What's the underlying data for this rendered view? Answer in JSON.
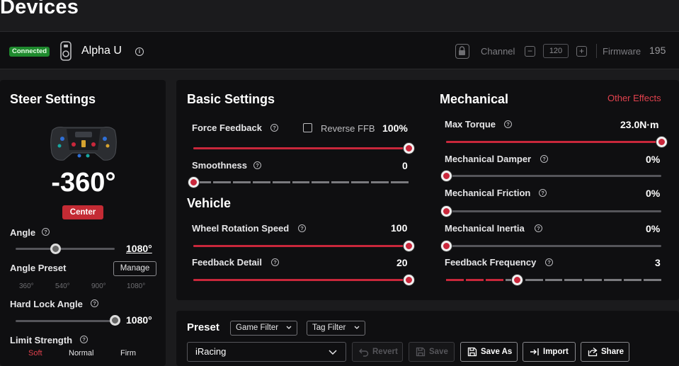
{
  "page": {
    "title": "Devices"
  },
  "device": {
    "status": "Connected",
    "name": "Alpha U",
    "channel_label": "Channel",
    "channel_value": "120",
    "minus": "−",
    "plus": "+",
    "firmware_label": "Firmware",
    "firmware_value": "195"
  },
  "steer": {
    "title": "Steer Settings",
    "angle_display": "-360°",
    "center_label": "Center",
    "angle_label": "Angle",
    "angle_value": "1080°",
    "angle_fraction": 0.4,
    "angle_preset_label": "Angle Preset",
    "manage_label": "Manage",
    "presets": [
      "360°",
      "540°",
      "900°",
      "1080°"
    ],
    "hard_lock_label": "Hard Lock Angle",
    "hard_lock_value": "1080°",
    "hard_lock_fraction": 1.0,
    "limit_strength_label": "Limit Strength",
    "limit_options": [
      "Soft",
      "Normal",
      "Firm"
    ]
  },
  "basic": {
    "title": "Basic Settings",
    "force_feedback_label": "Force Feedback",
    "reverse_ffb_label": "Reverse FFB",
    "force_feedback_value": "100%",
    "force_feedback_fraction": 1.0,
    "smoothness_label": "Smoothness",
    "smoothness_value": "0",
    "smoothness_fraction": 0.0
  },
  "vehicle": {
    "title": "Vehicle",
    "wheel_rotation_label": "Wheel Rotation Speed",
    "wheel_rotation_value": "100",
    "wheel_rotation_fraction": 1.0,
    "feedback_detail_label": "Feedback Detail",
    "feedback_detail_value": "20",
    "feedback_detail_fraction": 1.0
  },
  "mechanical": {
    "title": "Mechanical",
    "other_effects": "Other Effects",
    "max_torque_label": "Max Torque",
    "max_torque_value": "23.0N·m",
    "max_torque_fraction": 1.0,
    "damper_label": "Mechanical Damper",
    "damper_value": "0%",
    "friction_label": "Mechanical Friction",
    "friction_value": "0%",
    "inertia_label": "Mechanical Inertia",
    "inertia_value": "0%",
    "frequency_label": "Feedback Frequency",
    "frequency_value": "3",
    "frequency_fraction": 0.33
  },
  "preset": {
    "title": "Preset",
    "game_filter": "Game Filter",
    "tag_filter": "Tag Filter",
    "selected": "iRacing",
    "revert": "Revert",
    "save": "Save",
    "save_as": "Save As",
    "import": "Import",
    "share": "Share"
  },
  "colors": {
    "accent": "#c9273b",
    "connected": "#1f8a2e",
    "panel": "#0f0f11",
    "background": "#1b1b1d"
  }
}
